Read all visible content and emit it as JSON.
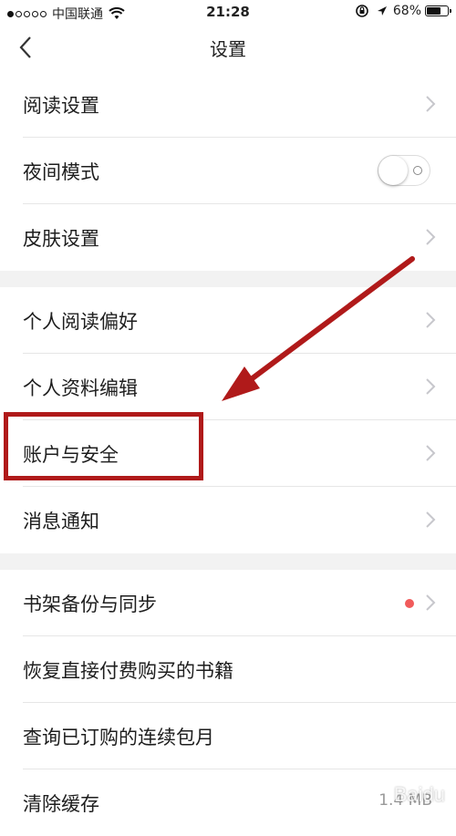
{
  "status_bar": {
    "carrier": "中国联通",
    "time": "21:28",
    "battery": "68%",
    "battery_fraction": 0.68
  },
  "nav": {
    "title": "设置"
  },
  "groups": [
    {
      "items": [
        {
          "label": "阅读设置",
          "type": "chevron"
        },
        {
          "label": "夜间模式",
          "type": "toggle",
          "on": false
        },
        {
          "label": "皮肤设置",
          "type": "chevron"
        }
      ]
    },
    {
      "items": [
        {
          "label": "个人阅读偏好",
          "type": "chevron"
        },
        {
          "label": "个人资料编辑",
          "type": "chevron"
        },
        {
          "label": "账户与安全",
          "type": "chevron"
        },
        {
          "label": "消息通知",
          "type": "chevron"
        }
      ]
    },
    {
      "items": [
        {
          "label": "书架备份与同步",
          "type": "chevron",
          "badge": "red-dot"
        },
        {
          "label": "恢复直接付费购买的书籍",
          "type": "none"
        },
        {
          "label": "查询已订购的连续包月",
          "type": "none"
        },
        {
          "label": "清除缓存",
          "type": "value",
          "value": "1.4 MB"
        }
      ]
    }
  ],
  "colors": {
    "accent_red": "#b01a1a",
    "badge_red": "#f15b5b",
    "chevron": "#c7c7cc",
    "group_gap": "#f2f2f2"
  },
  "watermark": "Baidu"
}
